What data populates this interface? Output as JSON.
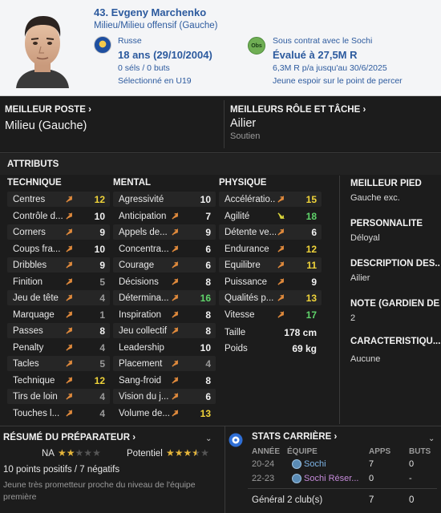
{
  "player": {
    "name": "43. Evgeny Marchenko",
    "position": "Milieu/Milieu offensif (Gauche)",
    "nationality": "Russe",
    "age_dob": "18 ans (29/10/2004)",
    "caps": "0 séls / 0 buts",
    "selection": "Sélectionné en U19",
    "contract": "Sous contrat avec le Sochi",
    "value": "Évalué à 27,5M R",
    "wage": "6,3M R p/a jusqu'au 30/6/2025",
    "status": "Jeune espoir sur le point de percer",
    "obs_badge": "Obs"
  },
  "best": {
    "pos_label": "MEILLEUR POSTE",
    "pos_value": "Milieu (Gauche)",
    "role_label": "MEILLEURS RÔLE ET TÂCHE",
    "role_value": "Ailier",
    "role_duty": "Soutien"
  },
  "attributes": {
    "title": "ATTRIBUTS",
    "technique_title": "TECHNIQUE",
    "mental_title": "MENTAL",
    "physique_title": "PHYSIQUE",
    "technique": [
      {
        "name": "Centres",
        "value": "12",
        "trend": "up"
      },
      {
        "name": "Contrôle d...",
        "value": "10",
        "trend": "up"
      },
      {
        "name": "Corners",
        "value": "9",
        "trend": "up"
      },
      {
        "name": "Coups fra...",
        "value": "10",
        "trend": "up"
      },
      {
        "name": "Dribbles",
        "value": "9",
        "trend": "up"
      },
      {
        "name": "Finition",
        "value": "5",
        "trend": "up"
      },
      {
        "name": "Jeu de tête",
        "value": "4",
        "trend": "up"
      },
      {
        "name": "Marquage",
        "value": "1",
        "trend": "up"
      },
      {
        "name": "Passes",
        "value": "8",
        "trend": "up"
      },
      {
        "name": "Penalty",
        "value": "4",
        "trend": "up"
      },
      {
        "name": "Tacles",
        "value": "5",
        "trend": "up"
      },
      {
        "name": "Technique",
        "value": "12",
        "trend": "up"
      },
      {
        "name": "Tirs de loin",
        "value": "4",
        "trend": "up"
      },
      {
        "name": "Touches l...",
        "value": "4",
        "trend": "up"
      }
    ],
    "mental": [
      {
        "name": "Agressivité",
        "value": "10",
        "trend": ""
      },
      {
        "name": "Anticipation",
        "value": "7",
        "trend": "up"
      },
      {
        "name": "Appels de...",
        "value": "9",
        "trend": "up"
      },
      {
        "name": "Concentra...",
        "value": "6",
        "trend": "up"
      },
      {
        "name": "Courage",
        "value": "6",
        "trend": "up"
      },
      {
        "name": "Décisions",
        "value": "8",
        "trend": "up"
      },
      {
        "name": "Détermina...",
        "value": "16",
        "trend": "up"
      },
      {
        "name": "Inspiration",
        "value": "8",
        "trend": "up"
      },
      {
        "name": "Jeu collectif",
        "value": "8",
        "trend": "up"
      },
      {
        "name": "Leadership",
        "value": "10",
        "trend": ""
      },
      {
        "name": "Placement",
        "value": "4",
        "trend": "up"
      },
      {
        "name": "Sang-froid",
        "value": "8",
        "trend": "up"
      },
      {
        "name": "Vision du j...",
        "value": "6",
        "trend": "up"
      },
      {
        "name": "Volume de...",
        "value": "13",
        "trend": "up"
      }
    ],
    "physique": [
      {
        "name": "Accélératio...",
        "value": "15",
        "trend": "up"
      },
      {
        "name": "Agilité",
        "value": "18",
        "trend": "down"
      },
      {
        "name": "Détente ve...",
        "value": "6",
        "trend": "up"
      },
      {
        "name": "Endurance",
        "value": "12",
        "trend": "up"
      },
      {
        "name": "Équilibre",
        "value": "11",
        "trend": "up"
      },
      {
        "name": "Puissance",
        "value": "9",
        "trend": "up"
      },
      {
        "name": "Qualités p...",
        "value": "13",
        "trend": "up"
      },
      {
        "name": "Vitesse",
        "value": "17",
        "trend": "up"
      }
    ],
    "height_label": "Taille",
    "height_value": "178 cm",
    "weight_label": "Poids",
    "weight_value": "69 kg"
  },
  "side": {
    "foot_title": "MEILLEUR PIED",
    "foot_value": "Gauche exc.",
    "pers_title": "PERSONNALITÉ",
    "pers_value": "Déloyal",
    "desc_title": "DESCRIPTION DES...",
    "desc_value": "Ailier",
    "note_title": "NOTE (GARDIEN DE...",
    "note_value": "2",
    "carac_title": "CARACTÉRISTIQU...",
    "carac_value": "Aucune"
  },
  "coach": {
    "title": "RÉSUMÉ DU PRÉPARATEUR",
    "na_label": "NA",
    "na_stars": 2,
    "pot_label": "Potentiel",
    "pot_stars": 3.5,
    "points": "10 points positifs / 7 négatifs",
    "desc": "Jeune très prometteur proche du niveau de l'équipe première"
  },
  "career": {
    "title": "STATS CARRIÈRE",
    "col_year": "ANNÉE",
    "col_team": "ÉQUIPE",
    "col_apps": "APPS",
    "col_goals": "BUTS",
    "rows": [
      {
        "year": "20-24",
        "team": "Sochi",
        "apps": "7",
        "goals": "0"
      },
      {
        "year": "22-23",
        "team": "Sochi Réser...",
        "apps": "0",
        "goals": "-"
      }
    ],
    "total_label": "Général 2 club(s)",
    "total_apps": "7",
    "total_goals": "0"
  },
  "colors": {
    "accent_blue": "#2c5a9e",
    "arrow_orange": "#e08a3c",
    "arrow_yellow": "#d8d43a",
    "val_yellow": "#f0d43a",
    "val_green": "#5fd36a",
    "val_white": "#f2f2f2",
    "val_gray": "#9a9a9a"
  }
}
